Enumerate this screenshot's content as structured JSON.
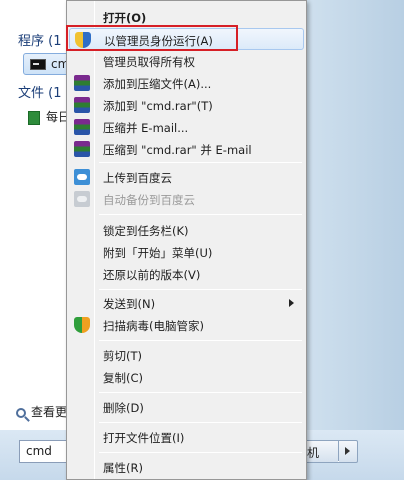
{
  "start_menu": {
    "programs_header": "程序 (1",
    "program_item": "cm",
    "files_header": "文件 (1",
    "file_item": "每日",
    "see_more": "查看更",
    "search_value": "cmd",
    "shutdown_label": "机"
  },
  "context_menu": {
    "items": [
      {
        "label": "打开(O)"
      },
      {
        "label": "以管理员身份运行(A)"
      },
      {
        "label": "管理员取得所有权"
      },
      {
        "label": "添加到压缩文件(A)..."
      },
      {
        "label": "添加到 \"cmd.rar\"(T)"
      },
      {
        "label": "压缩并 E-mail..."
      },
      {
        "label": "压缩到 \"cmd.rar\" 并 E-mail"
      },
      {
        "label": "上传到百度云"
      },
      {
        "label": "自动备份到百度云"
      },
      {
        "label": "锁定到任务栏(K)"
      },
      {
        "label": "附到「开始」菜单(U)"
      },
      {
        "label": "还原以前的版本(V)"
      },
      {
        "label": "发送到(N)"
      },
      {
        "label": "扫描病毒(电脑管家)"
      },
      {
        "label": "剪切(T)"
      },
      {
        "label": "复制(C)"
      },
      {
        "label": "删除(D)"
      },
      {
        "label": "打开文件位置(I)"
      },
      {
        "label": "属性(R)"
      }
    ]
  },
  "colors": {
    "highlight_border": "#d61f26",
    "menu_background": "#f0f0f0"
  }
}
